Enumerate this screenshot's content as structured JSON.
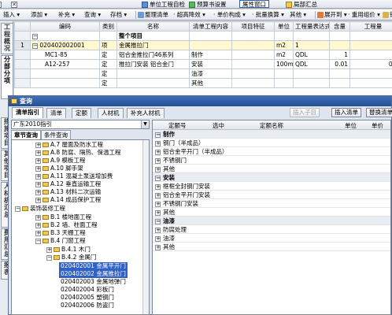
{
  "toolbar_top": {
    "items": [
      "单位工程自检",
      "预算书设置",
      "属性窗口",
      "局部汇总"
    ]
  },
  "toolbar_main": {
    "items": [
      "插入",
      "添加",
      "补充",
      "查询",
      "存档",
      "整理清单",
      "超高降效",
      "单价构成",
      "批量换算",
      "其他",
      "展开到",
      "重用组价",
      "锁定"
    ]
  },
  "sidebar": {
    "tabs": [
      "工程概况",
      "分部分项",
      "措施项目",
      "其他项目",
      "人材机汇总",
      "费用汇总",
      "报表"
    ]
  },
  "grid": {
    "columns": [
      "编码",
      "类别",
      "名称",
      "清单工程内容",
      "项目特征",
      "单位",
      "工程量表达式",
      "含量",
      "工程量"
    ],
    "rows": [
      {
        "num": "",
        "code": "",
        "type": "",
        "name": "整个项目",
        "content": "",
        "feature": "",
        "unit": "",
        "expr": "",
        "qty": "",
        "amount": ""
      },
      {
        "num": "1",
        "code": "020402002001",
        "type": "项",
        "name": "金属推拉门",
        "content": "",
        "feature": "",
        "unit": "m2",
        "expr": "1",
        "qty": "",
        "amount": ""
      },
      {
        "num": "",
        "code": "MC1-85",
        "type": "定",
        "name": "铝合金推拉门46系列",
        "content": "制作",
        "feature": "",
        "unit": "m2",
        "expr": "QDL",
        "qty": "1",
        "amount": ""
      },
      {
        "num": "",
        "code": "A12-257",
        "type": "定",
        "name": "推拉门安装 铝合金门",
        "content": "安装",
        "feature": "",
        "unit": "100m2",
        "expr": "QDL",
        "qty": "0.01",
        "amount": "0."
      },
      {
        "num": "",
        "code": "",
        "type": "定",
        "name": "",
        "content": "油漆",
        "feature": "",
        "unit": "",
        "expr": "",
        "qty": "",
        "amount": ""
      },
      {
        "num": "",
        "code": "",
        "type": "定",
        "name": "",
        "content": "其他",
        "feature": "",
        "unit": "",
        "expr": "",
        "qty": "",
        "amount": ""
      }
    ]
  },
  "dialog": {
    "title": "查询",
    "tabs": [
      "清单指引",
      "清单",
      "定额",
      "人材机",
      "补充人材机"
    ],
    "buttons": {
      "insert_sub": "插入子目",
      "insert_list": "插入清单",
      "replace_list": "替换清单"
    },
    "combo_value": "广东2010指引",
    "search_tabs": [
      "章节查询",
      "条件查询"
    ],
    "tree": [
      {
        "label": "A.7 屋面及防水工程",
        "sign": "+",
        "level": 1
      },
      {
        "label": "A.8 防腐、隔热、保温工程",
        "sign": "+",
        "level": 1
      },
      {
        "label": "A.9 模板工程",
        "sign": "+",
        "level": 1
      },
      {
        "label": "A.10 脚手架",
        "sign": "+",
        "level": 1
      },
      {
        "label": "A.11 混凝土泵送增加费",
        "sign": "+",
        "level": 1
      },
      {
        "label": "A.12 垂直运输工程",
        "sign": "+",
        "level": 1
      },
      {
        "label": "A.13 材料二次运输",
        "sign": "+",
        "level": 1
      },
      {
        "label": "A.14 成品保护工程",
        "sign": "+",
        "level": 1
      },
      {
        "label": "装饰装修工程",
        "sign": "-",
        "level": 0
      },
      {
        "label": "B.1 楼地面工程",
        "sign": "+",
        "level": 1
      },
      {
        "label": "B.2 墙、柱面工程",
        "sign": "+",
        "level": 1
      },
      {
        "label": "B.3 天棚工程",
        "sign": "+",
        "level": 1
      },
      {
        "label": "B.4 门窗工程",
        "sign": "-",
        "level": 1
      },
      {
        "label": "B.4.1 木门",
        "sign": "+",
        "level": 2
      },
      {
        "label": "B.4.2 金属门",
        "sign": "-",
        "level": 2
      },
      {
        "label": "020402001  金属平开门",
        "sign": "",
        "level": 3
      },
      {
        "label": "020402002  金属推拉门",
        "sign": "",
        "level": 3
      },
      {
        "label": "020402003  金属地弹门",
        "sign": "",
        "level": 3
      },
      {
        "label": "020402004  彩板门",
        "sign": "",
        "level": 3
      },
      {
        "label": "020402005  塑钢门",
        "sign": "",
        "level": 3
      },
      {
        "label": "020402006  防盗门",
        "sign": "",
        "level": 3
      }
    ],
    "result_columns": [
      "定额号",
      "选中",
      "定额名称",
      "单位",
      "单价"
    ],
    "results": [
      {
        "label": "制作",
        "group": true
      },
      {
        "label": "钢门（半成品）",
        "group": false
      },
      {
        "label": "铝合金平开门（半成品）",
        "group": false
      },
      {
        "label": "不锈钢门",
        "group": false
      },
      {
        "label": "其他",
        "group": false
      },
      {
        "label": "安装",
        "group": true
      },
      {
        "label": "框框全封钢门安装",
        "group": false
      },
      {
        "label": "铝合金平开门安装",
        "group": false
      },
      {
        "label": "不锈钢门安装",
        "group": false
      },
      {
        "label": "其他",
        "group": false
      },
      {
        "label": "油漆",
        "group": true
      },
      {
        "label": "防腐处理",
        "group": false
      },
      {
        "label": "油漆",
        "group": false
      },
      {
        "label": "其他",
        "group": false
      }
    ]
  }
}
